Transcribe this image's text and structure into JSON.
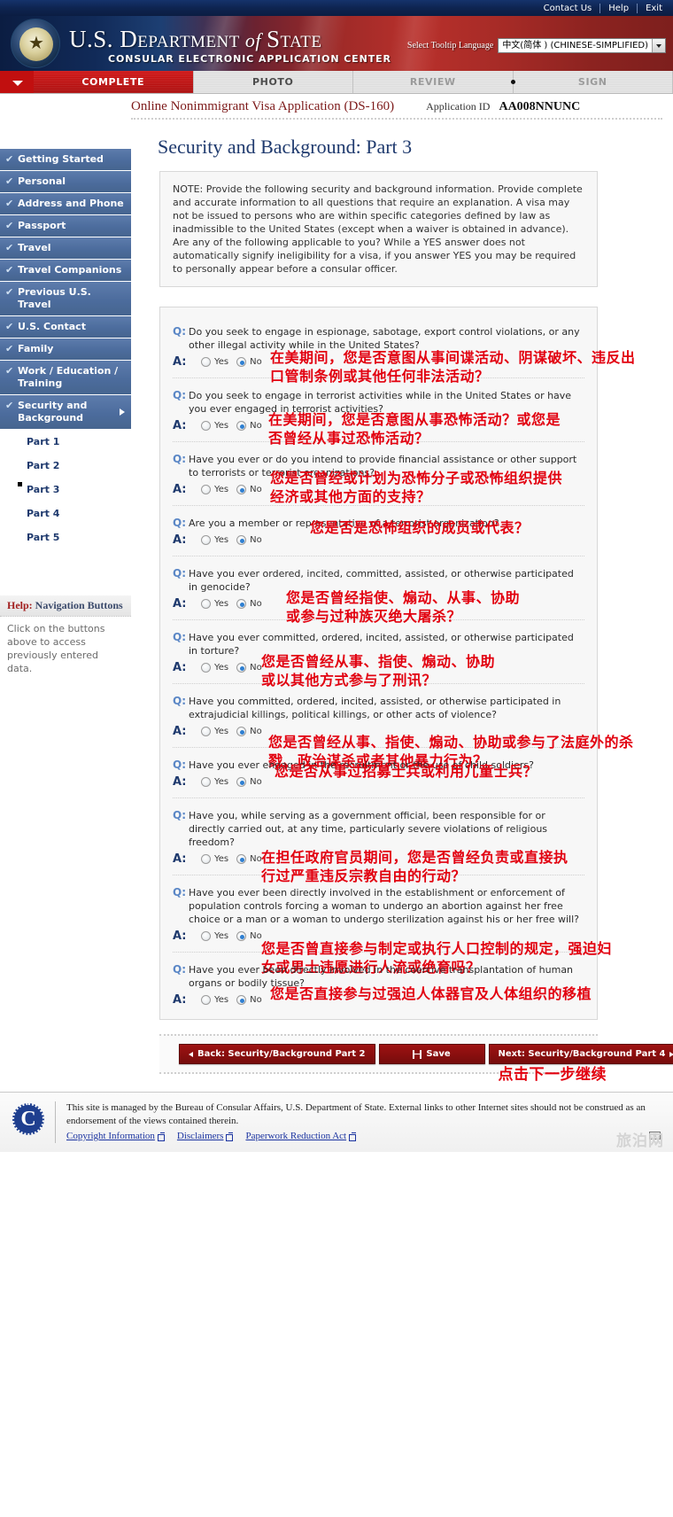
{
  "topbar": {
    "links": [
      {
        "label": "Contact Us",
        "name": "contact-us-link"
      },
      {
        "label": "Help",
        "name": "help-link"
      },
      {
        "label": "Exit",
        "name": "exit-link"
      }
    ]
  },
  "banner": {
    "dept_us": "U.S. ",
    "dept_d": "D",
    "dept_epartment": "EPARTMENT",
    "dept_of": " of ",
    "dept_s": "S",
    "dept_tate": "TATE",
    "subtitle": "CONSULAR ELECTRONIC APPLICATION CENTER",
    "lang_label": "Select Tooltip Language",
    "lang_value": "中文(简体 ) (CHINESE-SIMPLIFIED)"
  },
  "stages": [
    {
      "label": "COMPLETE",
      "state": "active"
    },
    {
      "label": "PHOTO",
      "state": "lit"
    },
    {
      "label": "REVIEW",
      "state": "dim"
    },
    {
      "label": "SIGN",
      "state": "dim"
    }
  ],
  "header": {
    "app_title": "Online Nonimmigrant Visa Application (DS-160)",
    "app_id_label": "Application ID",
    "app_id_value": "AA008NNUNC",
    "page_title": "Security and Background: Part 3"
  },
  "sidebar": {
    "items": [
      {
        "label": "Getting Started",
        "name": "sidebar-item-getting-started"
      },
      {
        "label": "Personal",
        "name": "sidebar-item-personal"
      },
      {
        "label": "Address and Phone",
        "name": "sidebar-item-address-and-phone"
      },
      {
        "label": "Passport",
        "name": "sidebar-item-passport"
      },
      {
        "label": "Travel",
        "name": "sidebar-item-travel"
      },
      {
        "label": "Travel Companions",
        "name": "sidebar-item-travel-companions"
      },
      {
        "label": "Previous U.S. Travel",
        "name": "sidebar-item-previous-us-travel"
      },
      {
        "label": "U.S. Contact",
        "name": "sidebar-item-us-contact"
      },
      {
        "label": "Family",
        "name": "sidebar-item-family"
      },
      {
        "label": "Work / Education / Training",
        "name": "sidebar-item-work-education-training"
      },
      {
        "label": "Security and Background",
        "name": "sidebar-item-security-and-background",
        "expanded": true
      }
    ],
    "subitems": [
      {
        "label": "Part 1",
        "current": false
      },
      {
        "label": "Part 2",
        "current": false
      },
      {
        "label": "Part 3",
        "current": true
      },
      {
        "label": "Part 4",
        "current": false
      },
      {
        "label": "Part 5",
        "current": false
      }
    ],
    "help": {
      "title_prefix": "Help:",
      "title": " Navigation Buttons",
      "body": "Click on the buttons above to access previously entered data."
    }
  },
  "note": "NOTE: Provide the following security and background information. Provide complete and accurate information to all questions that require an explanation. A visa may not be issued to persons who are within specific categories defined by law as inadmissible to the United States (except when a waiver is obtained in advance). Are any of the following applicable to you? While a YES answer does not automatically signify ineligibility for a visa, if you answer YES you may be required to personally appear before a consular officer.",
  "labels": {
    "q_mark": "Q:",
    "a_mark": "A:",
    "yes": "Yes",
    "no": "No"
  },
  "questions": [
    {
      "id": "espionage",
      "text": "Do you seek to engage in espionage, sabotage, export control violations, or any other illegal activity while in the United States?",
      "answer": "No",
      "cn": "在美期间，您是否意图从事间谍活动、阴谋破坏、违反出口管制条例或其他任何非法活动？"
    },
    {
      "id": "terrorist-activities",
      "text": "Do you seek to engage in terrorist activities while in the United States or have you ever engaged in terrorist activities?",
      "answer": "No",
      "cn": "在美期间，您是否意图从事恐怖活动？或您是否曾经从事过恐怖活动？"
    },
    {
      "id": "financial-support-terrorists",
      "text": "Have you ever or do you intend to provide financial assistance or other support to terrorists or terrorist organizations?",
      "answer": "No",
      "cn": "您是否曾经或计划为恐怖分子或恐怖组织提供经济或其他方面的支持？"
    },
    {
      "id": "terrorist-member",
      "text": "Are you a member or representative of a terrorist organization?",
      "answer": "No",
      "cn": "您是否是恐怖组织的成员或代表？"
    },
    {
      "id": "genocide",
      "text": "Have you ever ordered, incited, committed, assisted, or otherwise participated in genocide?",
      "answer": "No",
      "cn": "您是否曾经指使、煽动、从事、协助或参与过种族灭绝大屠杀？"
    },
    {
      "id": "torture",
      "text": "Have you ever committed, ordered, incited, assisted, or otherwise participated in torture?",
      "answer": "No",
      "cn": "您是否曾经从事、指使、煽动、协助或以其他方式参与了刑讯？"
    },
    {
      "id": "extrajudicial-killings",
      "text": "Have you committed, ordered, incited, assisted, or otherwise participated in extrajudicial killings, political killings, or other acts of violence?",
      "answer": "No",
      "cn": "您是否曾经从事、指使、煽动、协助或参与了法庭外的杀戮、政治谋杀或者其他暴力行为？"
    },
    {
      "id": "child-soldiers",
      "text": "Have you ever engaged in the recruitment or the use of child soldiers?",
      "answer": "No",
      "cn": "您是否从事过招募士兵或利用儿童士兵？"
    },
    {
      "id": "religious-freedom",
      "text": "Have you, while serving as a government official, been responsible for or directly carried out, at any time, particularly severe violations of religious freedom?",
      "answer": "No",
      "cn": "在担任政府官员期间，您是否曾经负责或直接执行过严重违反宗教自由的行动？"
    },
    {
      "id": "population-controls",
      "text": "Have you ever been directly involved in the establishment or enforcement of population controls forcing a woman to undergo an abortion against her free choice or a man or a woman to undergo sterilization against his or her free will?",
      "answer": "No",
      "cn": "您是否曾直接参与制定或执行人口控制的规定，强迫妇女或男士违愿进行人流或绝育吗？"
    },
    {
      "id": "coercive-transplantation",
      "text": "Have you ever been directly involved in the coercive transplantation of human organs or bodily tissue?",
      "answer": "No",
      "cn": "您是否直接参与过强迫人体器官及人体组织的移植"
    }
  ],
  "buttons": {
    "back": "Back: Security/Background Part 2",
    "save": "Save",
    "next": "Next: Security/Background Part 4",
    "cn_hint": "点击下一步继续"
  },
  "footer": {
    "text": "This site is managed by the Bureau of Consular Affairs, U.S. Department of State. External links to other Internet sites should not be construed as an endorsement of the views contained therein.",
    "links": [
      {
        "label": "Copyright Information",
        "name": "copyright-information-link"
      },
      {
        "label": "Disclaimers",
        "name": "disclaimers-link"
      },
      {
        "label": "Paperwork Reduction Act",
        "name": "paperwork-reduction-act-link"
      }
    ],
    "badge": "⠿",
    "watermark": "旅泊网"
  },
  "colors": {
    "accent_red": "#c10f0f",
    "nav_blue": "#4f6fa0",
    "title_blue": "#1f3a6e",
    "annotation_red": "#e2000f"
  }
}
